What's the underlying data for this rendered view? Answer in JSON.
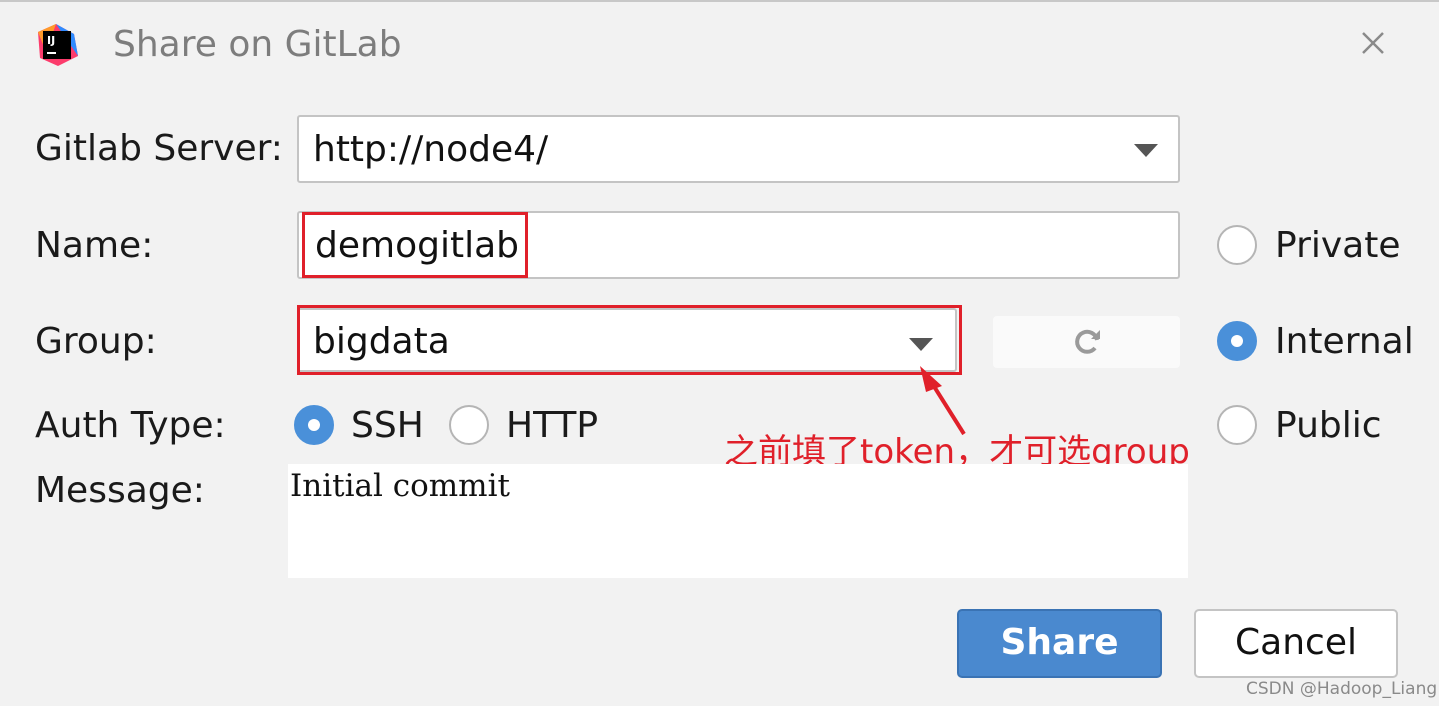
{
  "window": {
    "title": "Share on GitLab",
    "logo_text": "IJ"
  },
  "form": {
    "server_label": "Gitlab Server:",
    "server_value": "http://node4/",
    "name_label": "Name:",
    "name_value": "demogitlab",
    "group_label": "Group:",
    "group_value": "bigdata",
    "auth_label": "Auth Type:",
    "auth_options": [
      {
        "label": "SSH",
        "selected": true
      },
      {
        "label": "HTTP",
        "selected": false
      }
    ],
    "message_label": "Message:",
    "message_value": "Initial commit"
  },
  "visibility": [
    {
      "label": "Private",
      "selected": false
    },
    {
      "label": "Internal",
      "selected": true
    },
    {
      "label": "Public",
      "selected": false
    }
  ],
  "annotation": "之前填了token，才可选group",
  "buttons": {
    "share": "Share",
    "cancel": "Cancel"
  },
  "watermark": "CSDN @Hadoop_Liang",
  "icons": {
    "logo": "intellij-logo-icon",
    "close": "close-icon",
    "refresh": "refresh-icon",
    "dropdown": "chevron-down-icon"
  },
  "colors": {
    "accent": "#4a89cf",
    "annotation_red": "#e0202a",
    "title_gray": "#7d7d7d"
  }
}
